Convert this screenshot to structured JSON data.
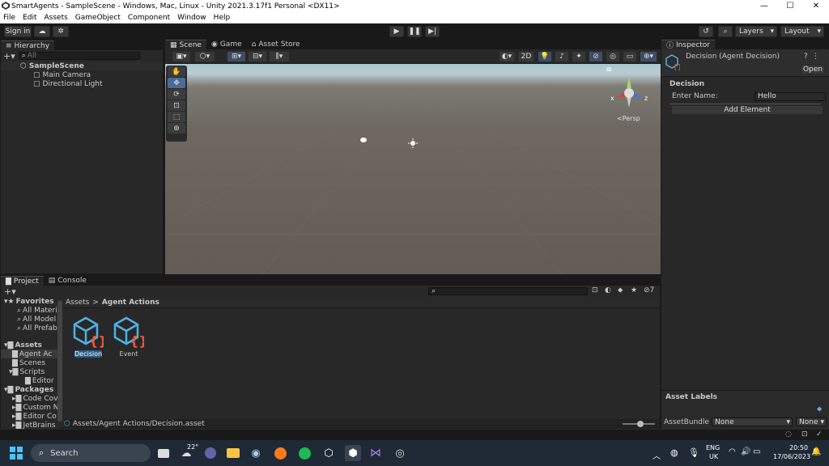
{
  "window": {
    "title": "SmartAgents - SampleScene - Windows, Mac, Linux - Unity 2021.3.17f1 Personal <DX11>",
    "controls": {
      "minimize": "—",
      "maximize": "☐",
      "close": "✕"
    }
  },
  "menubar": [
    "File",
    "Edit",
    "Assets",
    "GameObject",
    "Component",
    "Window",
    "Help"
  ],
  "toolbar": {
    "sign_in": "Sign in",
    "layers": "Layers",
    "layout": "Layout"
  },
  "hierarchy": {
    "tab": "Hierarchy",
    "search_placeholder": "All",
    "scene": "SampleScene",
    "items": [
      "Main Camera",
      "Directional Light"
    ]
  },
  "scene_tabs": [
    "Scene",
    "Game",
    "Asset Store"
  ],
  "scene_view": {
    "toggle_2d": "2D",
    "persp_label": "<Persp",
    "axis_x": "x",
    "axis_z": "z"
  },
  "inspector": {
    "tab": "Inspector",
    "title": "Decision (Agent Decision)",
    "open_button": "Open",
    "section": "Decision",
    "field_label": "Enter Name:",
    "field_value": "Hello",
    "add_button": "Add Element",
    "asset_labels": "Asset Labels",
    "asset_bundle_label": "AssetBundle",
    "asset_bundle_value": "None",
    "asset_variant_value": "None"
  },
  "project": {
    "tabs": [
      "Project",
      "Console"
    ],
    "hidden_count": "7",
    "favorites": "Favorites",
    "favorites_items": [
      "All Materi",
      "All Model",
      "All Prefab"
    ],
    "assets": "Assets",
    "assets_items": [
      "Agent Ac",
      "Scenes",
      "Scripts"
    ],
    "scripts_child": "Editor",
    "packages": "Packages",
    "packages_items": [
      "Code Cov",
      "Custom N",
      "Editor Co",
      "JetBrains"
    ],
    "breadcrumb": [
      "Assets",
      "Agent Actions"
    ],
    "asset_items": [
      "Decision",
      "Event"
    ],
    "status_path": "Assets/Agent Actions/Decision.asset"
  },
  "taskbar": {
    "search": "Search",
    "weather_temp": "22°",
    "lang": "ENG",
    "region": "UK",
    "time": "20:50",
    "date": "17/06/2023"
  },
  "colors": {
    "accent": "#4c7fd1",
    "asset_icon": "#4fb1e6",
    "asset_braces": "#e25a3c"
  }
}
